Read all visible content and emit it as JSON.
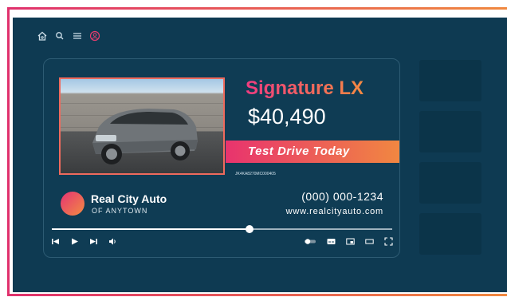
{
  "vehicle": {
    "name": "Signature LX",
    "price": "$40,490",
    "cta": "Test Drive Today",
    "vin": "JK4KA8270MC000405"
  },
  "dealer": {
    "name": "Real City Auto",
    "subtitle": "OF ANYTOWN",
    "phone": "(000) 000-1234",
    "website": "www.realcityauto.com"
  },
  "player": {
    "progress_fraction": 0.58
  },
  "icons": {
    "nav": [
      "home-icon",
      "search-icon",
      "menu-icon",
      "account-icon"
    ],
    "controls_left": [
      "skip-previous-icon",
      "play-icon",
      "skip-next-icon",
      "volume-icon"
    ],
    "controls_right": [
      "autoplay-toggle-icon",
      "captions-icon",
      "miniplayer-icon",
      "theater-mode-icon",
      "fullscreen-icon"
    ]
  },
  "colors": {
    "accent_start": "#e8336e",
    "accent_end": "#f18741",
    "background": "#0e3a52"
  }
}
